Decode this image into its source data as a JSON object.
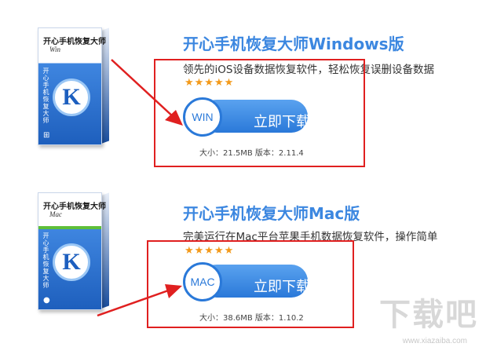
{
  "products": [
    {
      "box_title": "开心手机恢复大师",
      "box_subtitle": "Win",
      "box_vertical": "开心手机恢复大师",
      "box_letter": "K",
      "title": "开心手机恢复大师Windows版",
      "description": "领先的iOS设备数据恢复软件，轻松恢复误删设备数据",
      "stars": "★★★★★",
      "badge": "WIN",
      "button_label": "立即下载",
      "meta": "大小：21.5MB 版本：2.11.4"
    },
    {
      "box_title": "开心手机恢复大师",
      "box_subtitle": "Mac",
      "box_vertical": "开心手机恢复大师",
      "box_letter": "K",
      "title": "开心手机恢复大师Mac版",
      "description": "完美运行在Mac平台苹果手机数据恢复软件，操作简单",
      "stars": "★★★★★",
      "badge": "MAC",
      "button_label": "立即下载",
      "meta": "大小：38.6MB 版本：1.10.2"
    }
  ],
  "watermark": {
    "text": "下载吧",
    "url": "www.xiazaiba.com"
  },
  "colors": {
    "accent": "#3c87e0",
    "highlight": "#e02020",
    "star": "#f39a1b"
  },
  "icons": [
    "product-box-icon",
    "red-arrow-icon"
  ]
}
